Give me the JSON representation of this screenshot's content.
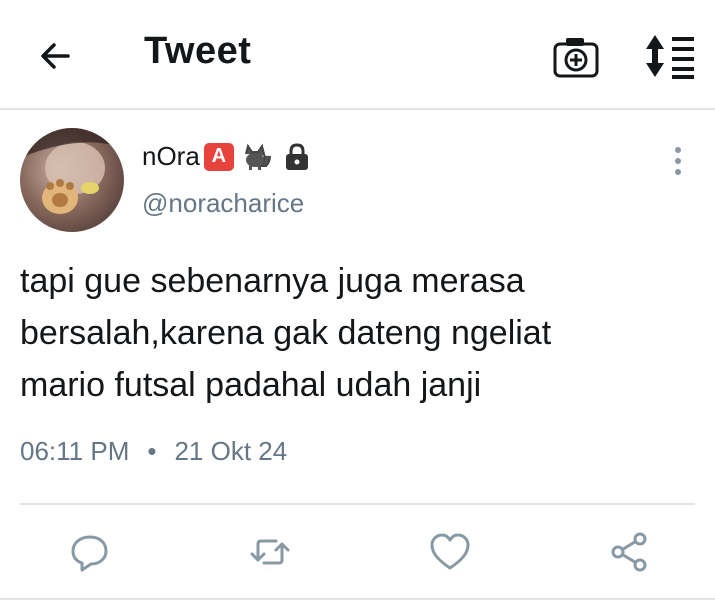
{
  "header": {
    "title": "Tweet",
    "back_icon": "arrow-left-icon",
    "camera_icon": "camera-plus-icon",
    "sort_icon": "sort-list-icon"
  },
  "tweet": {
    "display_name": "nOra",
    "badge": "A",
    "emojis": [
      "cat-icon",
      "lock-icon"
    ],
    "handle": "@noracharice",
    "text": "tapi gue sebenarnya juga merasa\nbersalah,karena gak dateng ngeliat\nmario futsal padahal udah janji",
    "time": "06:11 PM",
    "separator": "•",
    "date": "21 Okt 24"
  },
  "actions": [
    "reply-icon",
    "retweet-icon",
    "like-icon",
    "share-icon"
  ],
  "colors": {
    "text": "#14171a",
    "muted": "#657786",
    "icon": "#8899a6",
    "divider": "#e1e5e8",
    "badge": "#e8423d"
  }
}
